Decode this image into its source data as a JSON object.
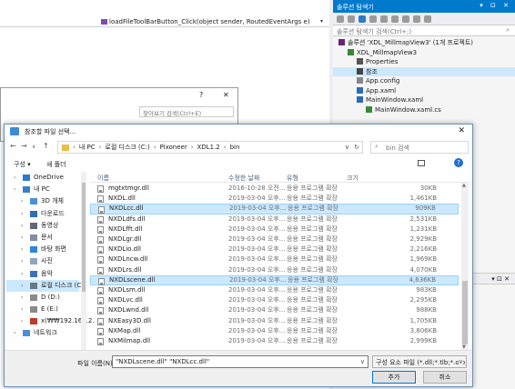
{
  "vs": {
    "method": "loadFileToolBarButton_Click(object sender, RoutedEventArgs e)",
    "solution_explorer": {
      "title": "솔루션 탐색기",
      "title_buttons": "▾ ⊡ ✕",
      "search_placeholder": "솔루션 탐색기 검색(Ctrl+;)",
      "tree": [
        {
          "label": "솔루션 'XDL_MillmapView3' (1개 프로젝트)",
          "indent": 0,
          "icon": "solution-icon"
        },
        {
          "label": "XDL_MillmapView3",
          "indent": 1,
          "icon": "csharp-project-icon"
        },
        {
          "label": "Properties",
          "indent": 2,
          "icon": "wrench-icon"
        },
        {
          "label": "참조",
          "indent": 2,
          "icon": "references-icon",
          "selected": true
        },
        {
          "label": "App.config",
          "indent": 2,
          "icon": "config-file-icon"
        },
        {
          "label": "App.xaml",
          "indent": 2,
          "icon": "xaml-file-icon"
        },
        {
          "label": "MainWindow.xaml",
          "indent": 2,
          "icon": "xaml-file-icon"
        },
        {
          "label": "MainWindow.xaml.cs",
          "indent": 3,
          "icon": "csharp-file-icon"
        }
      ],
      "pin": "▾ ⊡ ✕"
    },
    "bg_window": {
      "help": "?",
      "close": "✕",
      "search_placeholder": "찾아보기 검색(Ctrl+E)"
    }
  },
  "dialog": {
    "title": "참조할 파일 선택...",
    "close": "✕",
    "nav": {
      "back": "←",
      "forward": "→",
      "recent": "∨",
      "up": "↑"
    },
    "path": [
      "내 PC",
      "로컬 디스크 (C:)",
      "Pixoneer",
      "XDL1.2",
      "bin"
    ],
    "path_sep": "›",
    "search_placeholder": "bin 검색",
    "toolbar": {
      "organize": "구성 ▾",
      "new_folder": "새 폴더",
      "help": "?"
    },
    "nav_items": [
      {
        "label": "OneDrive",
        "icon": "cloud-icon",
        "color": "#2f78d0",
        "indent": 0
      },
      {
        "label": "내 PC",
        "icon": "pc-icon",
        "color": "#3d7dca",
        "indent": 0
      },
      {
        "label": "3D 개체",
        "icon": "3d-objects-icon",
        "color": "#4a90d9",
        "indent": 1
      },
      {
        "label": "다운로드",
        "icon": "download-icon",
        "color": "#2d6db8",
        "indent": 1
      },
      {
        "label": "동영상",
        "icon": "video-icon",
        "color": "#5e6a78",
        "indent": 1
      },
      {
        "label": "문서",
        "icon": "documents-icon",
        "color": "#7d8ea3",
        "indent": 1
      },
      {
        "label": "바탕 화면",
        "icon": "desktop-icon",
        "color": "#2f86d6",
        "indent": 1
      },
      {
        "label": "사진",
        "icon": "pictures-icon",
        "color": "#8fa6bf",
        "indent": 1
      },
      {
        "label": "음악",
        "icon": "music-icon",
        "color": "#3b73b9",
        "indent": 1
      },
      {
        "label": "로컬 디스크 (C:)",
        "icon": "drive-icon",
        "color": "#6a7784",
        "indent": 1,
        "selected": true
      },
      {
        "label": "D (D:)",
        "icon": "drive-icon",
        "color": "#8a8a8a",
        "indent": 1
      },
      {
        "label": "E (E:)",
        "icon": "drive-icon",
        "color": "#8a8a8a",
        "indent": 1
      },
      {
        "label": "x(₩₩192.168.2.",
        "icon": "network-drive-icon",
        "color": "#c0392b",
        "indent": 1
      },
      {
        "label": "네트워크",
        "icon": "network-icon",
        "color": "#4a90d9",
        "indent": 0
      }
    ],
    "columns": {
      "name": "이름",
      "date": "수정한 날짜",
      "type": "유형",
      "size": "크기"
    },
    "files": [
      {
        "name": "mgtxtmgr.dll",
        "date": "2016-10-28 오전...",
        "type": "응용 프로그램 확장",
        "size": "30KB"
      },
      {
        "name": "NXDL.dll",
        "date": "2019-03-04 오후...",
        "type": "응용 프로그램 확장",
        "size": "1,461KB"
      },
      {
        "name": "NXDLcc.dll",
        "date": "2019-03-04 오후...",
        "type": "응용 프로그램 확장",
        "size": "909KB",
        "selected": true
      },
      {
        "name": "NXDLdfs.dll",
        "date": "2019-03-04 오후...",
        "type": "응용 프로그램 확장",
        "size": "2,531KB"
      },
      {
        "name": "NXDLfft.dll",
        "date": "2019-03-04 오후...",
        "type": "응용 프로그램 확장",
        "size": "1,231KB"
      },
      {
        "name": "NXDLgr.dll",
        "date": "2019-03-04 오후...",
        "type": "응용 프로그램 확장",
        "size": "2,929KB"
      },
      {
        "name": "NXDLio.dll",
        "date": "2019-03-04 오후...",
        "type": "응용 프로그램 확장",
        "size": "2,216KB"
      },
      {
        "name": "NXDLncw.dll",
        "date": "2019-03-04 오후...",
        "type": "응용 프로그램 확장",
        "size": "1,969KB"
      },
      {
        "name": "NXDLrs.dll",
        "date": "2019-03-04 오후...",
        "type": "응용 프로그램 확장",
        "size": "4,070KB"
      },
      {
        "name": "NXDLscene.dll",
        "date": "2019-03-04 오후...",
        "type": "응용 프로그램 확장",
        "size": "4,636KB",
        "selected": true
      },
      {
        "name": "NXDLsm.dll",
        "date": "2019-03-04 오후...",
        "type": "응용 프로그램 확장",
        "size": "983KB"
      },
      {
        "name": "NXDLvc.dll",
        "date": "2019-03-04 오후...",
        "type": "응용 프로그램 확장",
        "size": "2,295KB"
      },
      {
        "name": "NXDLwnd.dll",
        "date": "2019-03-04 오후...",
        "type": "응용 프로그램 확장",
        "size": "988KB"
      },
      {
        "name": "NXEasy3D.dll",
        "date": "2019-03-04 오후...",
        "type": "응용 프로그램 확장",
        "size": "1,705KB"
      },
      {
        "name": "NXMap.dll",
        "date": "2019-03-04 오후...",
        "type": "응용 프로그램 확장",
        "size": "3,806KB"
      },
      {
        "name": "NXMilmap.dll",
        "date": "2019-03-04 오후...",
        "type": "응용 프로그램 확장",
        "size": "2,999KB"
      }
    ],
    "filename_label": "파일 이름(N):",
    "filename_value": "\"NXDLscene.dll\" \"NXDLcc.dll\"",
    "filetype_value": "구성 요소 파일 (*.dll;*.tlb;*.olb;",
    "ok": "추가",
    "cancel": "취소",
    "selection_color": "#cce8ff"
  }
}
